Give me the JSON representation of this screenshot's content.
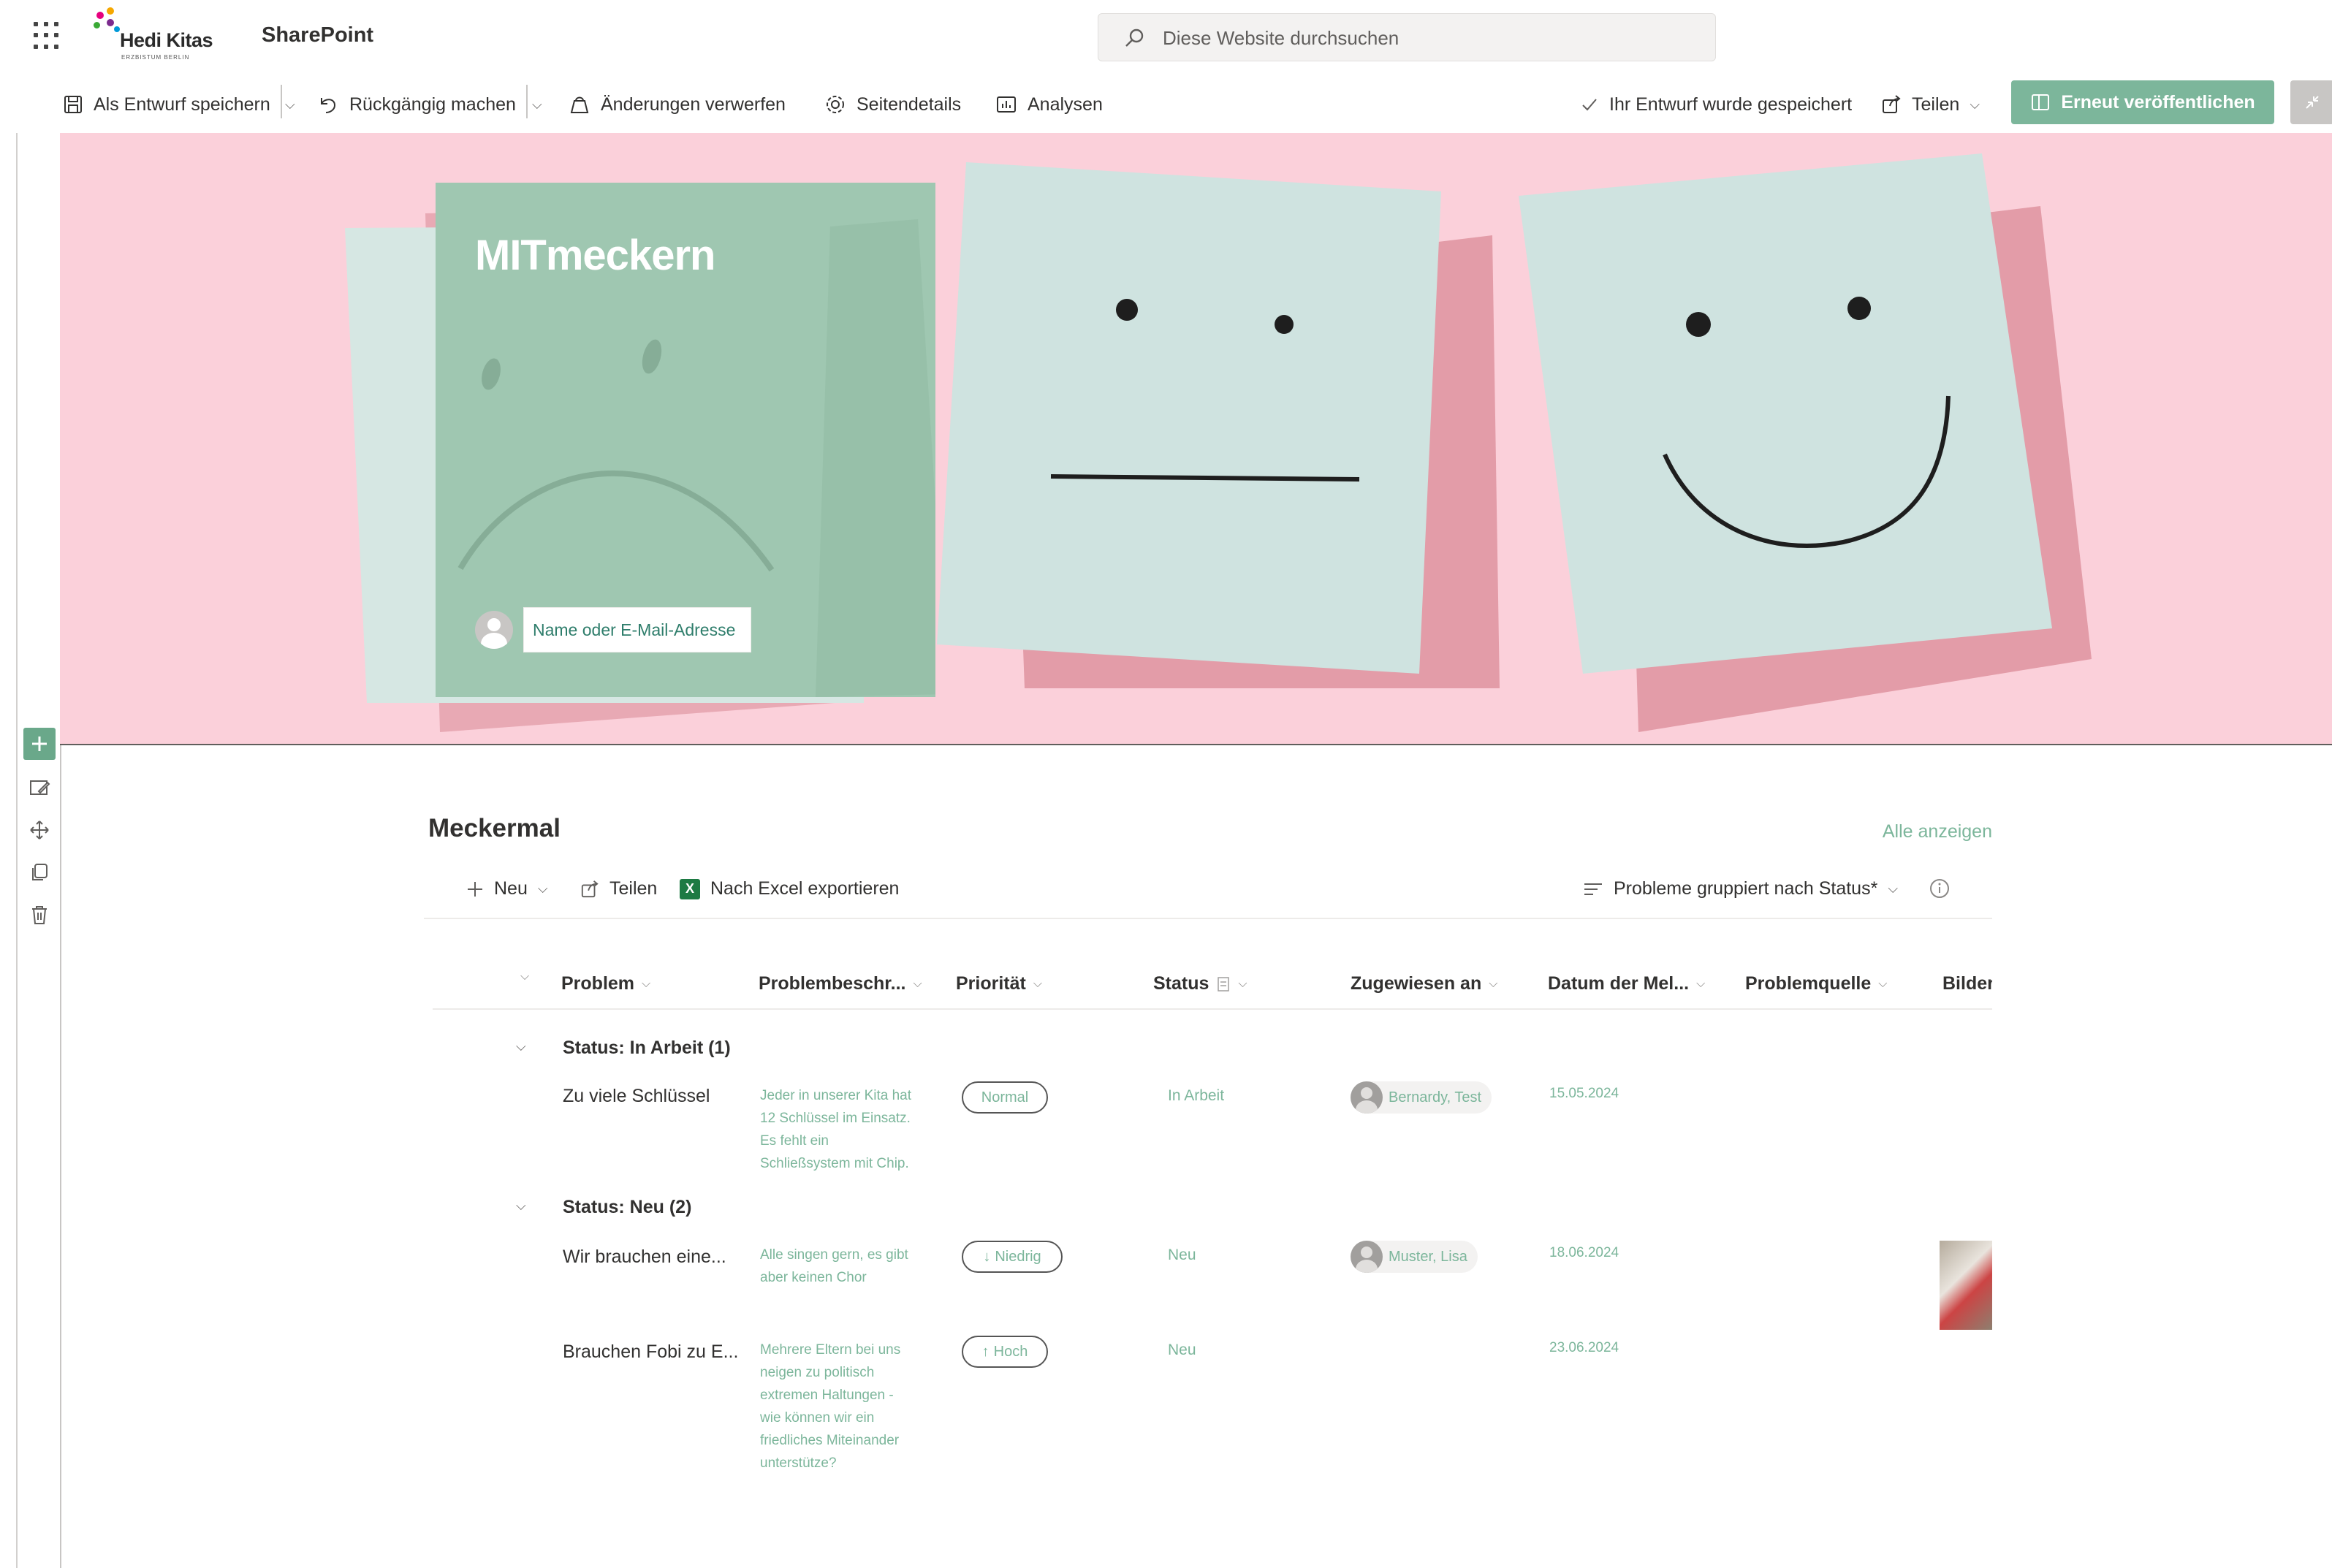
{
  "app": {
    "logo_name": "Hedi Kitas",
    "logo_sub": "ERZBISTUM BERLIN",
    "product": "SharePoint",
    "search_placeholder": "Diese Website durchsuchen"
  },
  "commandbar": {
    "save_draft": "Als Entwurf speichern",
    "undo": "Rückgängig machen",
    "discard": "Änderungen verwerfen",
    "page_details": "Seitendetails",
    "analytics": "Analysen",
    "saved_status": "Ihr Entwurf wurde gespeichert",
    "share": "Teilen",
    "republish": "Erneut veröffentlichen"
  },
  "hero": {
    "title": "MITmeckern",
    "author_placeholder": "Name oder E-Mail-Adresse"
  },
  "list": {
    "title": "Meckermal",
    "see_all": "Alle anzeigen",
    "new": "Neu",
    "share": "Teilen",
    "export": "Nach Excel exportieren",
    "view": "Probleme gruppiert nach Status*",
    "columns": [
      "Problem",
      "Problembeschr...",
      "Priorität",
      "Status",
      "Zugewiesen an",
      "Datum der Mel...",
      "Problemquelle",
      "Bilder"
    ],
    "groups": [
      {
        "label": "Status: In Arbeit (1)",
        "rows": [
          {
            "problem": "Zu viele Schlüssel",
            "description": [
              "Jeder in unserer Kita hat",
              "12 Schlüssel im Einsatz.",
              "Es fehlt ein",
              "Schließsystem mit Chip."
            ],
            "priority": "Normal",
            "status": "In Arbeit",
            "assigned": "Bernardy, Test",
            "date": "15.05.2024"
          }
        ]
      },
      {
        "label": "Status: Neu (2)",
        "rows": [
          {
            "problem": "Wir brauchen eine...",
            "description": [
              "Alle singen gern, es gibt",
              "aber keinen Chor"
            ],
            "priority": "Niedrig",
            "priority_arrow": "↓",
            "status": "Neu",
            "assigned": "Muster, Lisa",
            "date": "18.06.2024"
          },
          {
            "problem": "Brauchen Fobi zu E...",
            "description": [
              "Mehrere Eltern bei uns",
              "neigen zu politisch",
              "extremen Haltungen -",
              "wie können wir ein",
              "friedliches Miteinander",
              "unterstütze?"
            ],
            "priority": "Hoch",
            "priority_arrow": "↑",
            "status": "Neu",
            "assigned": "",
            "date": "23.06.2024"
          }
        ]
      }
    ]
  },
  "colors": {
    "accent": "#7cb69b",
    "hero_bg": "#fbd0da",
    "title_card": "#9fc7b1",
    "sticky_note": "#cfe3e0"
  }
}
